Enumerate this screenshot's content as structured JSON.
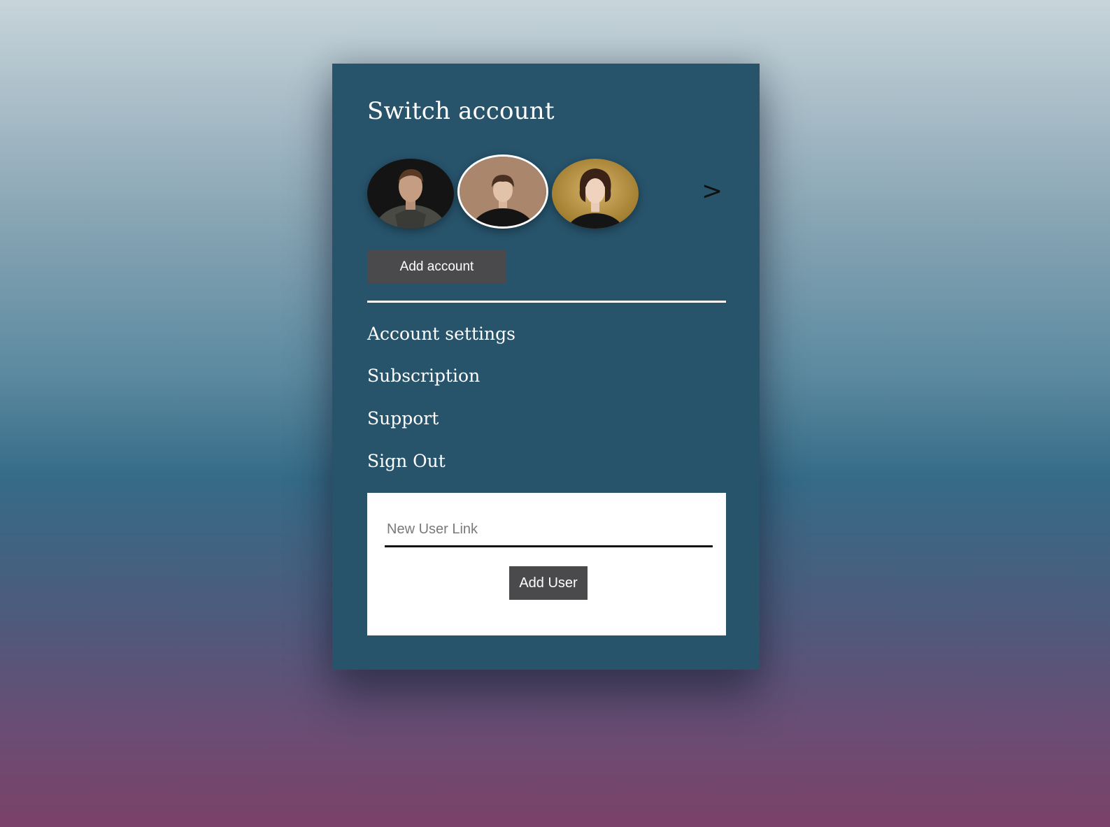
{
  "panel": {
    "title": "Switch account",
    "accounts": [
      {
        "name": "account-avatar-1",
        "icon": "man-portrait",
        "selected": false
      },
      {
        "name": "account-avatar-2",
        "icon": "boy-portrait",
        "selected": true
      },
      {
        "name": "account-avatar-3",
        "icon": "woman-portrait",
        "selected": false
      }
    ],
    "next_label": ">",
    "add_account_label": "Add account",
    "menu": [
      {
        "label": "Account settings"
      },
      {
        "label": "Subscription"
      },
      {
        "label": "Support"
      },
      {
        "label": "Sign Out"
      }
    ],
    "new_user": {
      "placeholder": "New User Link",
      "value": "",
      "button_label": "Add User"
    }
  },
  "colors": {
    "panel": "#27536b",
    "button": "#4a4a4c",
    "text": "#ffffff"
  }
}
